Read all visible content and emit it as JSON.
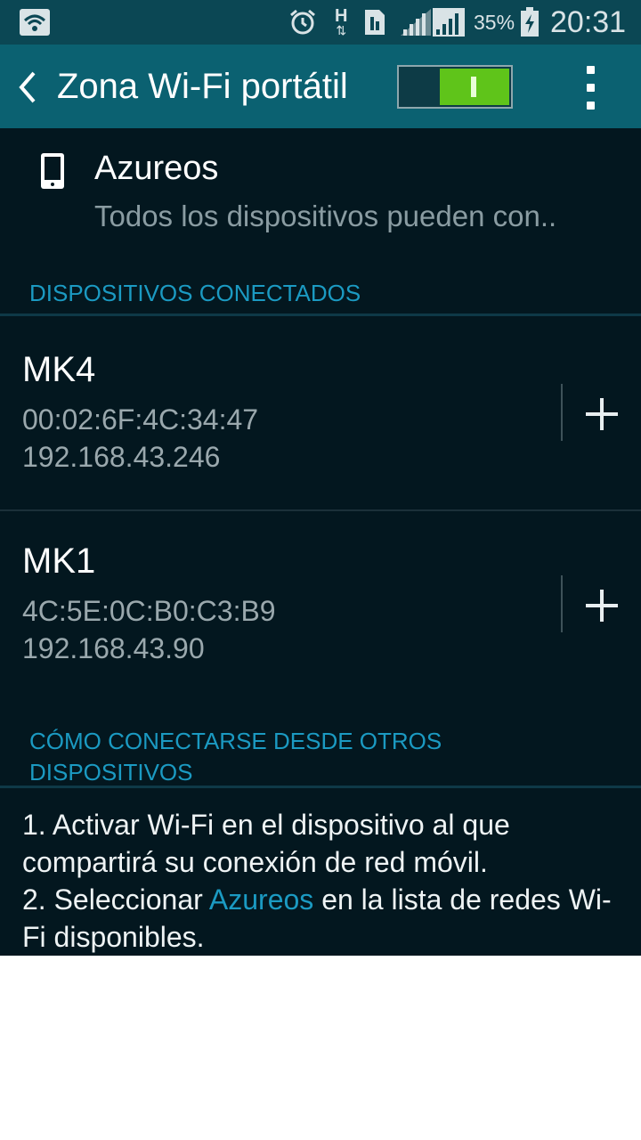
{
  "status_bar": {
    "battery_percent": "35%",
    "time": "20:31",
    "network_letter": "H",
    "icons": [
      "wifi-icon",
      "alarm-icon",
      "data-arrows-icon",
      "sim-icon",
      "signal-icon",
      "signal-icon",
      "battery-charging-icon"
    ]
  },
  "app_bar": {
    "title": "Zona Wi-Fi portátil",
    "toggle_on": true,
    "icons": [
      "back-arrow-icon",
      "overflow-menu-icon"
    ]
  },
  "hotspot": {
    "name": "Azureos",
    "description": "Todos los dispositivos pueden con..",
    "icon": "phone-icon"
  },
  "connected_devices": {
    "header": "DISPOSITIVOS CONECTADOS",
    "devices": [
      {
        "name": "MK4",
        "mac": "00:02:6F:4C:34:47",
        "ip": "192.168.43.246"
      },
      {
        "name": "MK1",
        "mac": "4C:5E:0C:B0:C3:B9",
        "ip": "192.168.43.90"
      }
    ]
  },
  "how_to": {
    "header_line1": "CÓMO CONECTARSE DESDE OTROS",
    "header_line2": "DISPOSITIVOS",
    "step1": "1. Activar Wi-Fi en el dispositivo al que compartirá su conexión de red móvil.",
    "step2_prefix": "2. Seleccionar ",
    "step2_link": "Azureos",
    "step2_suffix": " en la lista de redes Wi-Fi disponibles."
  },
  "colors": {
    "status_bar": "#0b4754",
    "app_bar": "#0b6171",
    "background": "#03171f",
    "accent": "#1b9ac2",
    "toggle_on": "#5fc41a"
  }
}
